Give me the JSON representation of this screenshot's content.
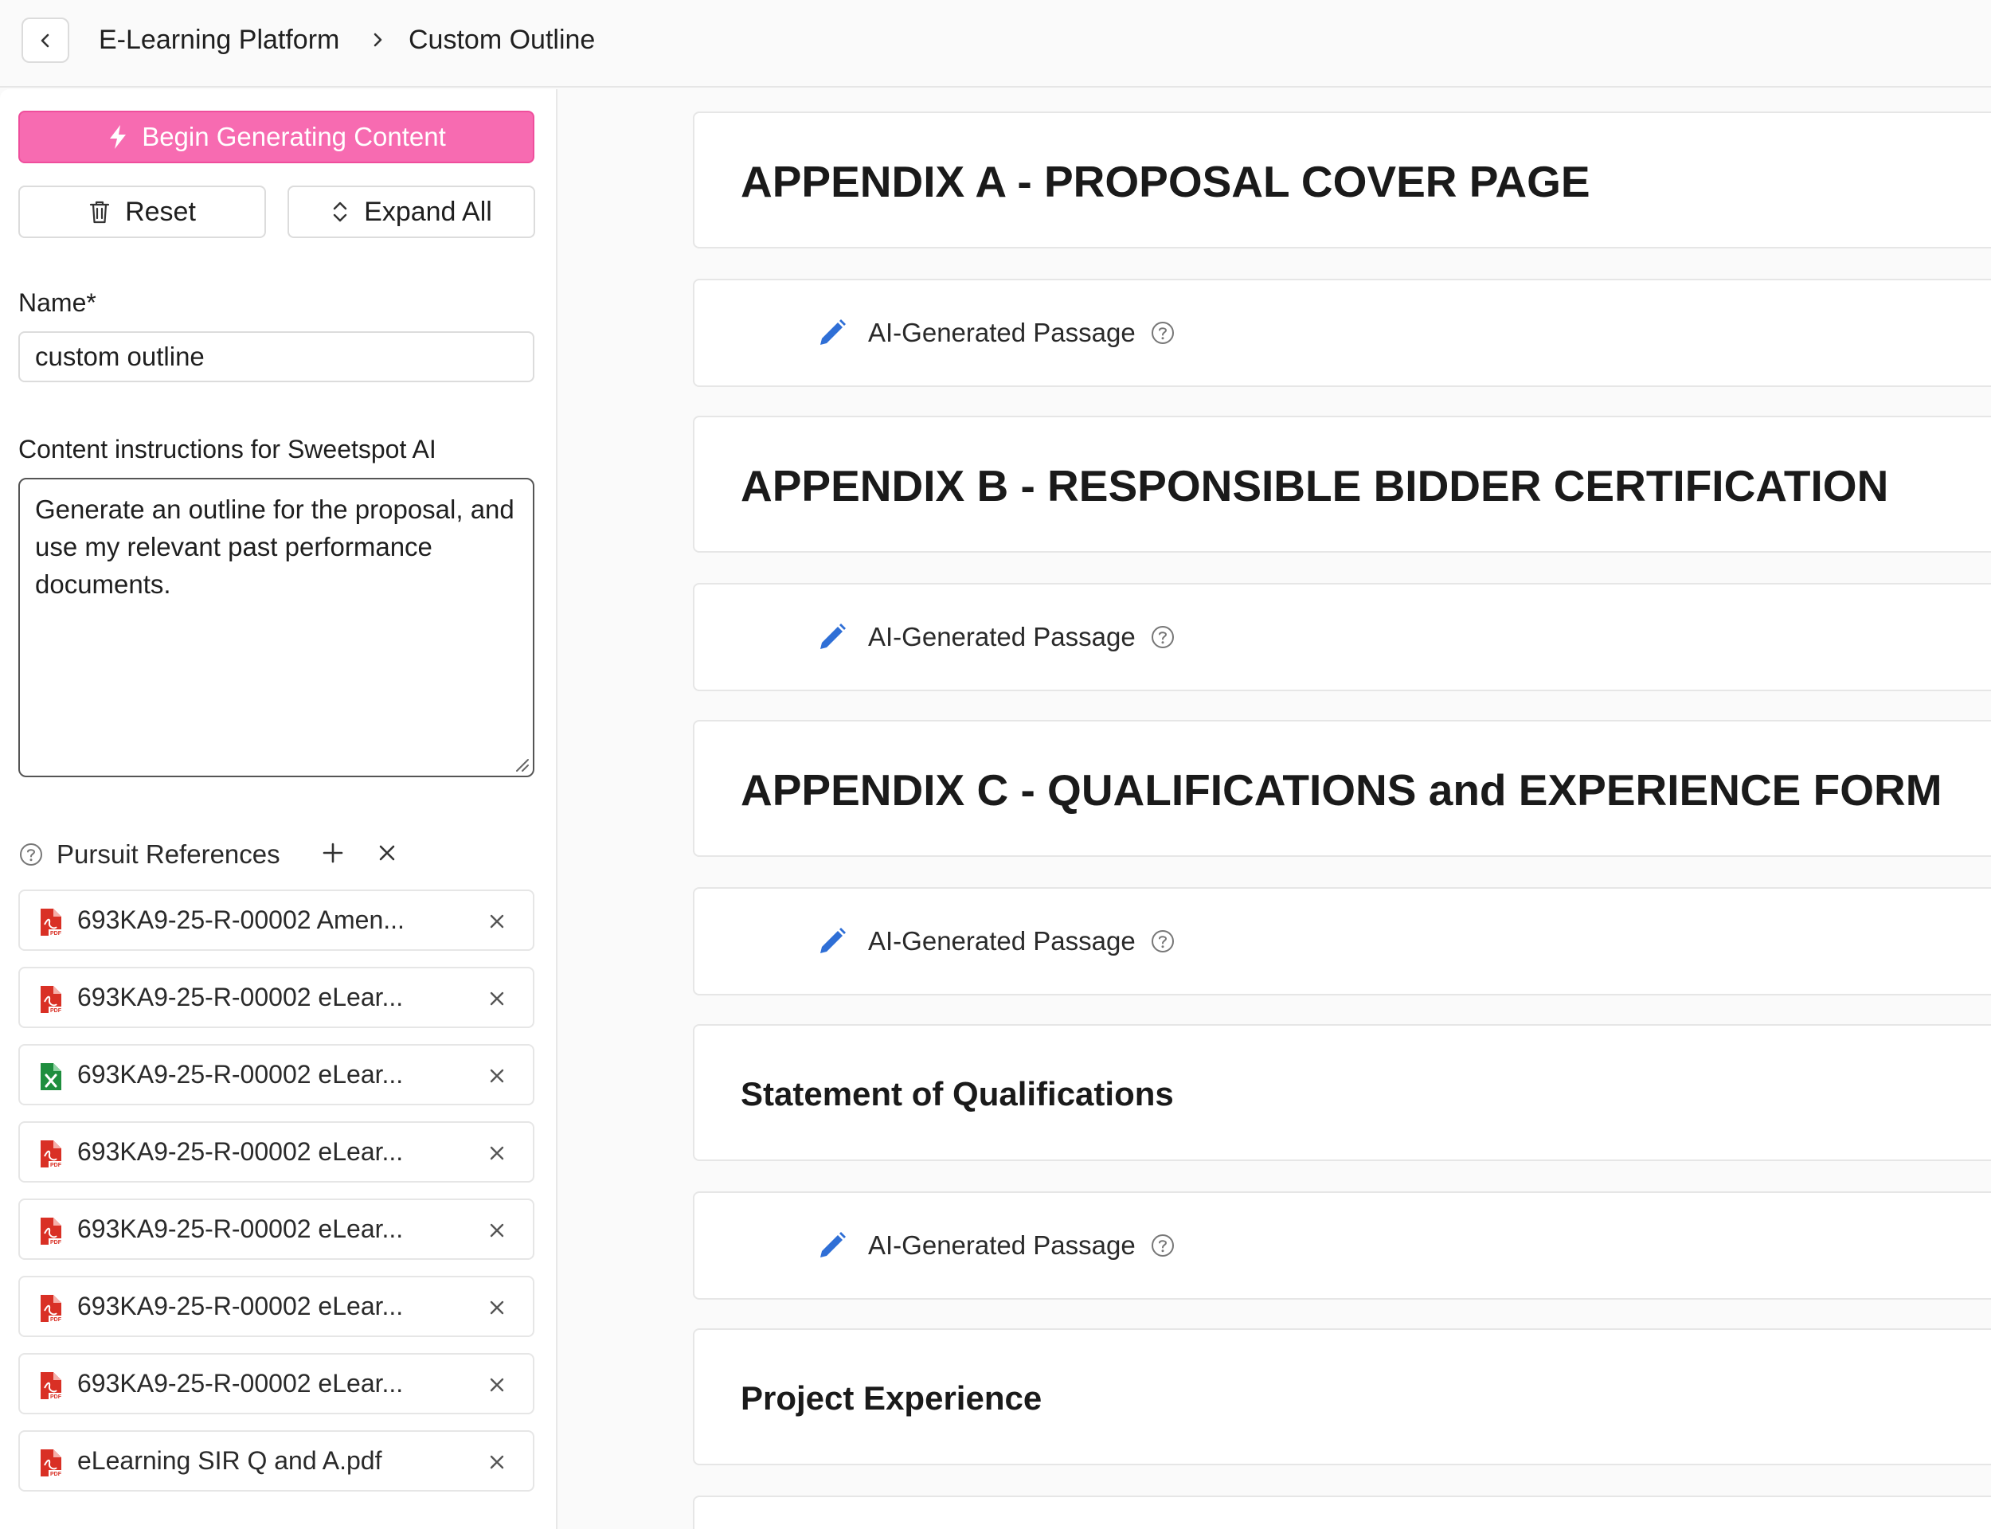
{
  "header": {
    "breadcrumb": [
      "E-Learning Platform",
      "Custom Outline"
    ]
  },
  "sidebar": {
    "generate_label": "Begin Generating Content",
    "reset_label": "Reset",
    "expand_label": "Expand All",
    "name_label": "Name*",
    "name_value": "custom outline",
    "instructions_label": "Content instructions for Sweetspot AI",
    "instructions_value": "Generate an outline for the proposal, and use my relevant past performance documents.",
    "references_title": "Pursuit References",
    "references": [
      {
        "name": "693KA9-25-R-00002 Amen...",
        "type": "pdf"
      },
      {
        "name": "693KA9-25-R-00002 eLear...",
        "type": "pdf"
      },
      {
        "name": "693KA9-25-R-00002 eLear...",
        "type": "xlsx"
      },
      {
        "name": "693KA9-25-R-00002 eLear...",
        "type": "pdf"
      },
      {
        "name": "693KA9-25-R-00002 eLear...",
        "type": "pdf"
      },
      {
        "name": "693KA9-25-R-00002 eLear...",
        "type": "pdf"
      },
      {
        "name": "693KA9-25-R-00002 eLear...",
        "type": "pdf"
      },
      {
        "name": "eLearning SIR Q and A.pdf",
        "type": "pdf"
      }
    ]
  },
  "outline": [
    {
      "kind": "heading",
      "title": "APPENDIX A - PROPOSAL COVER PAGE"
    },
    {
      "kind": "passage",
      "label": "AI-Generated Passage"
    },
    {
      "kind": "heading",
      "title": "APPENDIX B - RESPONSIBLE BIDDER CERTIFICATION"
    },
    {
      "kind": "passage",
      "label": "AI-Generated Passage"
    },
    {
      "kind": "heading",
      "title": "APPENDIX C - QUALIFICATIONS and EXPERIENCE FORM"
    },
    {
      "kind": "passage",
      "label": "AI-Generated Passage"
    },
    {
      "kind": "heading",
      "title": "Statement of Qualifications"
    },
    {
      "kind": "passage",
      "label": "AI-Generated Passage"
    },
    {
      "kind": "heading",
      "title": "Project Experience"
    }
  ],
  "colors": {
    "accent": "#f76bb1",
    "pencil": "#2f6fd6",
    "pdf": "#d93025",
    "xlsx": "#1e8e3e"
  }
}
